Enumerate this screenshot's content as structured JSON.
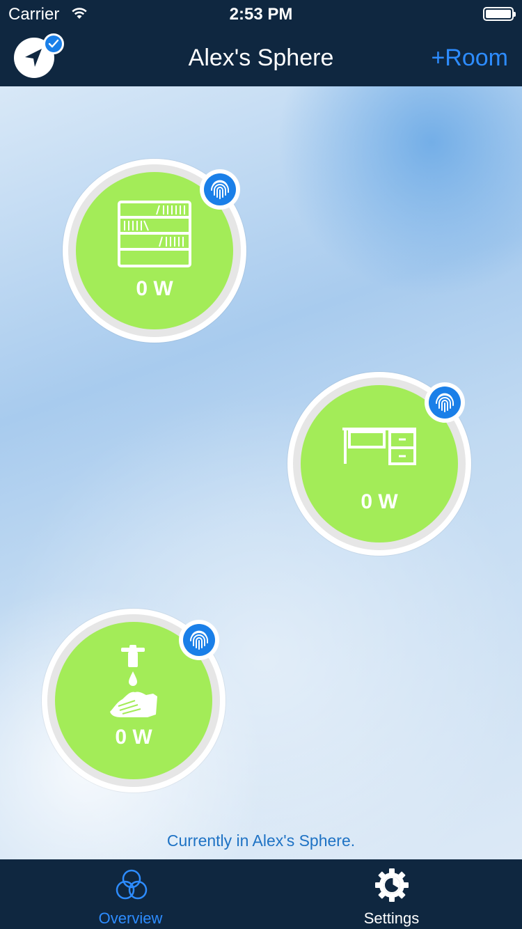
{
  "status_bar": {
    "carrier": "Carrier",
    "time": "2:53 PM"
  },
  "nav": {
    "title": "Alex's Sphere",
    "add_room_label": "+Room",
    "left_icon": "location-arrow-icon",
    "left_badge_icon": "checkmark-icon"
  },
  "rooms": [
    {
      "icon": "bookshelf-icon",
      "power": "0 W",
      "badge_icon": "fingerprint-icon"
    },
    {
      "icon": "desk-icon",
      "power": "0 W",
      "badge_icon": "fingerprint-icon"
    },
    {
      "icon": "hand-washing-icon",
      "power": "0 W",
      "badge_icon": "fingerprint-icon"
    }
  ],
  "footer": {
    "status_text": "Currently in Alex's Sphere."
  },
  "tabs": [
    {
      "label": "Overview",
      "icon": "overview-circles-icon",
      "selected": true
    },
    {
      "label": "Settings",
      "icon": "gear-icon",
      "selected": false
    }
  ],
  "colors": {
    "nav_background": "#0f2740",
    "accent_blue": "#2d8cff",
    "room_green": "#a3ec58",
    "badge_blue": "#1a7fe8"
  }
}
